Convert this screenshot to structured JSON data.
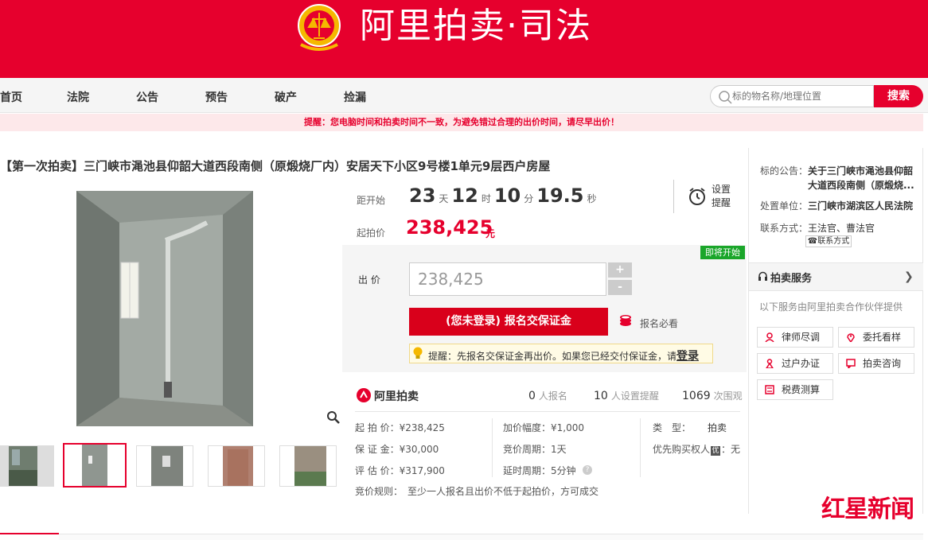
{
  "header": {
    "site_title": "阿里拍卖·司法",
    "brand_color": "#e6002d"
  },
  "nav": {
    "items": [
      "首页",
      "法院",
      "公告",
      "预告",
      "破产",
      "捡漏"
    ],
    "search_placeholder": "标的物名称/地理位置",
    "search_button": "搜索"
  },
  "notice": "提醒：您电脑时间和拍卖时间不一致，为避免错过合理的出价时间，请尽早出价！",
  "lot": {
    "title": "【第一次拍卖】三门峡市渑池县仰韶大道西段南侧（原煅烧厂内）安居天下小区9号楼1单元9层西户房屋",
    "countdown_label": "距开始",
    "countdown": {
      "days": "23",
      "days_unit": "天",
      "hours": "12",
      "hours_unit": "时",
      "minutes": "10",
      "minutes_unit": "分",
      "seconds": "19.5",
      "seconds_unit": "秒"
    },
    "reminder_label": "设置提醒",
    "start_price_label": "起拍价",
    "start_price": "238,425",
    "start_price_unit": "元",
    "status_badge": "即将开始",
    "bid_label": "出 价",
    "bid_value": "238,425",
    "plus": "+",
    "minus": "-",
    "signup_button": "(您未登录) 报名交保证金",
    "must_read": "报名必看",
    "tip_text": "提醒：先报名交保证金再出价。如果您已经交付保证金，请",
    "tip_login": "登录"
  },
  "stats": {
    "brand": "阿里拍卖",
    "signups": "0",
    "signups_unit": "人报名",
    "reminders": "10",
    "reminders_unit": "人设置提醒",
    "views": "1069",
    "views_unit": "次围观"
  },
  "details": {
    "start_price": "起 拍 价：¥238,425",
    "deposit": "保 证 金：¥30,000",
    "appraisal": "评 估 价：¥317,900",
    "increment": "加价幅度：¥1,000",
    "cycle": "竞价周期：1天",
    "delay": "延时周期：5分钟",
    "type_label": "类　型：",
    "type_value": "拍卖",
    "priority": "优先购买权人",
    "priority_value": "：无",
    "rules": "竞价规则：　至少一人报名且出价不低于起拍价，方可成交"
  },
  "sidebar": {
    "notice_label": "标的公告：",
    "notice_value_1": "关于三门峡市渑池县仰韶",
    "notice_value_2": "大道西段南侧（原煅烧...",
    "unit_label": "处置单位：",
    "unit_value": "三门峡市湖滨区人民法院",
    "contact_label": "联系方式：",
    "contact_value": "王法官、曹法官",
    "contact_button": "联系方式",
    "service_title": "拍卖服务",
    "service_sub": "以下服务由阿里拍卖合作伙伴提供",
    "services": [
      "律师尽调",
      "委托看样",
      "过户办证",
      "拍卖咨询",
      "税费测算"
    ]
  },
  "watermark": "红星新闻"
}
